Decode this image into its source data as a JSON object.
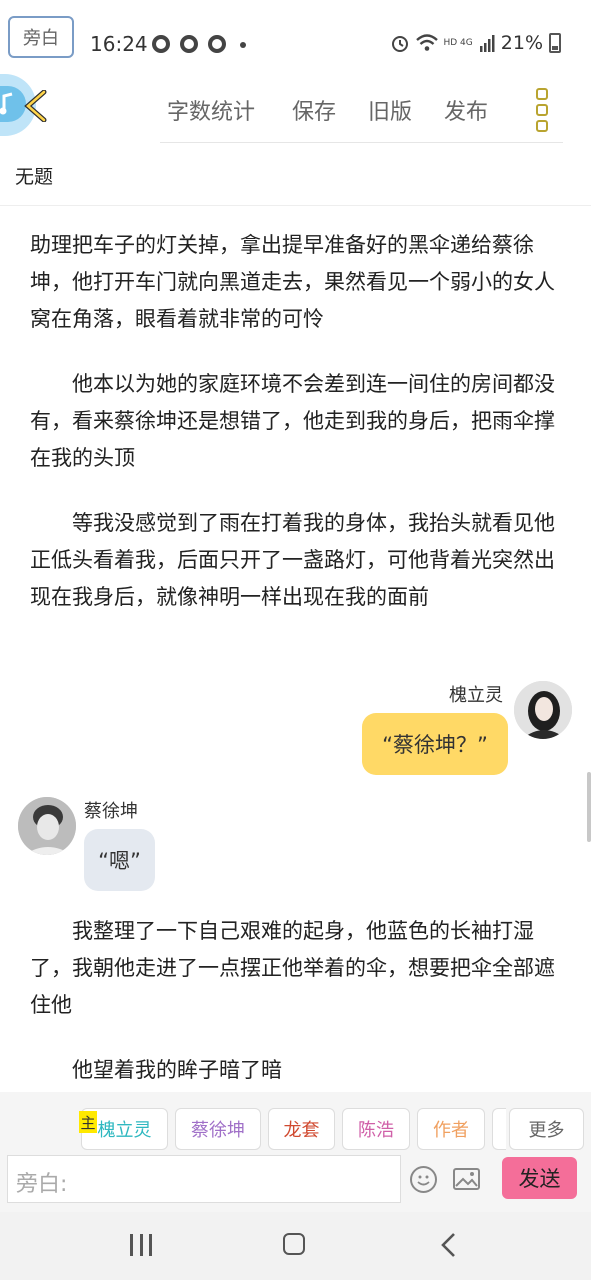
{
  "status_bar": {
    "time": "16:24",
    "right_text": "HD 4G",
    "battery": "21%"
  },
  "toolbar": {
    "word_count": "字数统计",
    "save": "保存",
    "old_version": "旧版",
    "publish": "发布"
  },
  "doc": {
    "title": "无题"
  },
  "content": {
    "p1": "助理把车子的灯关掉，拿出提早准备好的黑伞递给蔡徐坤，他打开车门就向黑道走去，果然看见一个弱小的女人窝在角落，眼看着就非常的可怜",
    "p2": "他本以为她的家庭环境不会差到连一间住的房间都没有，看来蔡徐坤还是想错了，他走到我的身后，把雨伞撑在我的头顶",
    "p3": "等我没感觉到了雨在打着我的身体，我抬头就看见他正低头看着我，后面只开了一盏路灯，可他背着光突然出现在我身后，就像神明一样出现在我的面前",
    "msg1": {
      "name": "槐立灵",
      "text": "“蔡徐坤？”"
    },
    "msg2": {
      "name": "蔡徐坤",
      "text": "“嗯”"
    },
    "p4": "我整理了一下自己艰难的起身，他蓝色的长袖打湿了，我朝他走进了一点摆正他举着的伞，想要把伞全部遮住他",
    "p5": "他望着我的眸子暗了暗"
  },
  "roles": {
    "items": [
      {
        "label": "旁白",
        "color": "#777777"
      },
      {
        "label": "槐立灵",
        "color": "#2fb8c0"
      },
      {
        "label": "蔡徐坤",
        "color": "#a070c8"
      },
      {
        "label": "龙套",
        "color": "#d04a30"
      },
      {
        "label": "陈浩",
        "color": "#d060a8"
      },
      {
        "label": "作者",
        "color": "#f0a060"
      }
    ],
    "main_tag": "主",
    "more": "更多"
  },
  "input": {
    "placeholder": "旁白:",
    "send": "发送"
  }
}
